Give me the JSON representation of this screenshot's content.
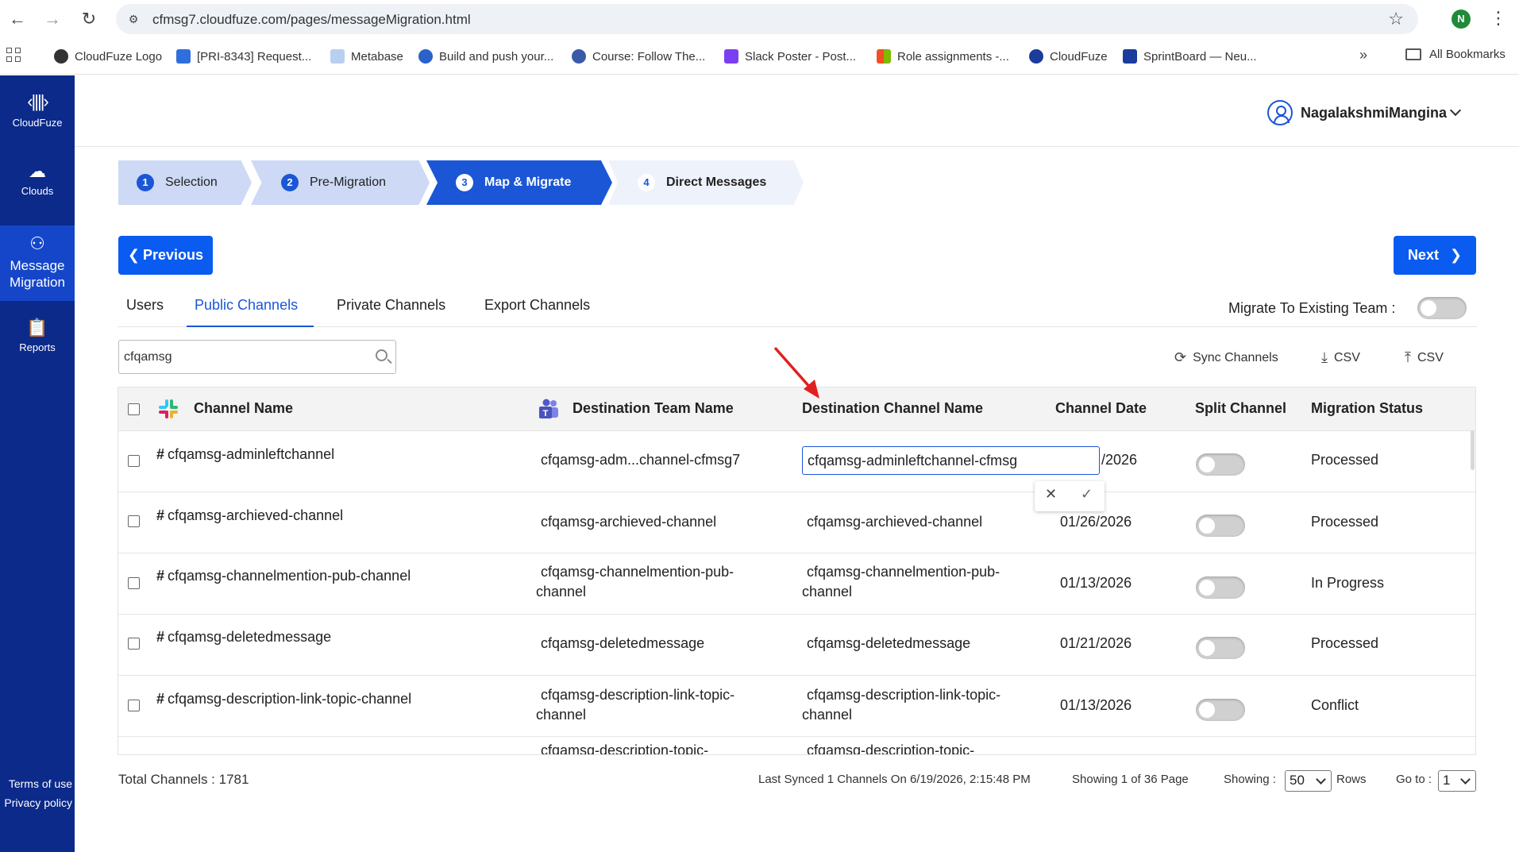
{
  "browser": {
    "url": "cfmsg7.cloudfuze.com/pages/messageMigration.html",
    "profile_initial": "N",
    "bookmarks": [
      {
        "label": "CloudFuze Logo",
        "color": "#333333"
      },
      {
        "label": "[PRI-8343] Request...",
        "color": "#2f6fdd"
      },
      {
        "label": "Metabase",
        "color": "#7aa7e0"
      },
      {
        "label": "Build and push your...",
        "color": "#2a62c9"
      },
      {
        "label": "Course: Follow The...",
        "color": "#3a5aa8"
      },
      {
        "label": "Slack Poster - Post...",
        "color": "#7b3ff2"
      },
      {
        "label": "Role assignments -...",
        "color": "#f25022"
      },
      {
        "label": "CloudFuze",
        "color": "#1a3c9c"
      },
      {
        "label": "SprintBoard — Neu...",
        "color": "#1a3c9c"
      }
    ],
    "all_bookmarks": "All Bookmarks"
  },
  "sidebar": {
    "brand": "CloudFuze",
    "items": [
      {
        "label": "Clouds",
        "icon": "cloud-icon"
      },
      {
        "label": "Message Migration",
        "icon": "users-icon"
      },
      {
        "label": "Reports",
        "icon": "clipboard-icon"
      }
    ],
    "terms": "Terms of use",
    "privacy": "Privacy policy"
  },
  "header": {
    "username": "NagalakshmiMangina"
  },
  "steps": [
    {
      "num": "1",
      "label": "Selection"
    },
    {
      "num": "2",
      "label": "Pre-Migration"
    },
    {
      "num": "3",
      "label": "Map & Migrate"
    },
    {
      "num": "4",
      "label": "Direct Messages"
    }
  ],
  "buttons": {
    "previous": "Previous",
    "next": "Next"
  },
  "tabs": [
    "Users",
    "Public Channels",
    "Private Channels",
    "Export Channels"
  ],
  "migrate_existing_label": "Migrate To Existing Team :",
  "search": {
    "value": "cfqamsg"
  },
  "actions": {
    "sync": "Sync Channels",
    "download_csv": "CSV",
    "upload_csv": "CSV"
  },
  "table": {
    "headers": {
      "channel": "Channel Name",
      "team": "Destination Team Name",
      "dest_channel": "Destination Channel Name",
      "date": "Channel Date",
      "split": "Split Channel",
      "status": "Migration Status"
    },
    "rows": [
      {
        "channel": "cfqamsg-adminleftchannel",
        "team": "cfqamsg-adm...channel-cfmsg7",
        "dest": "",
        "date": "/2026",
        "status": "Processed"
      },
      {
        "channel": "cfqamsg-archieved-channel",
        "team": "cfqamsg-archieved-channel",
        "dest": "cfqamsg-archieved-channel",
        "date": "01/26/2026",
        "status": "Processed"
      },
      {
        "channel": "cfqamsg-channelmention-pub-channel",
        "team": "cfqamsg-channelmention-pub-channel",
        "dest": "cfqamsg-channelmention-pub-channel",
        "date": "01/13/2026",
        "status": "In Progress"
      },
      {
        "channel": "cfqamsg-deletedmessage",
        "team": "cfqamsg-deletedmessage",
        "dest": "cfqamsg-deletedmessage",
        "date": "01/21/2026",
        "status": "Processed"
      },
      {
        "channel": "cfqamsg-description-link-topic-channel",
        "team": "cfqamsg-description-link-topic-channel",
        "dest": "cfqamsg-description-link-topic-channel",
        "date": "01/13/2026",
        "status": "Conflict"
      },
      {
        "channel": "",
        "team": "cfqamsg-description-topic-",
        "dest": "cfqamsg-description-topic-",
        "date": "",
        "status": ""
      }
    ],
    "edit_value": "cfqamsg-adminleftchannel-cfmsg"
  },
  "footer": {
    "total": "Total Channels : 1781",
    "last_synced": "Last Synced 1 Channels On 6/19/2026, 2:15:48 PM",
    "showing_page": "Showing 1 of 36 Page",
    "showing_label": "Showing :",
    "rows_value": "50",
    "rows_label": "Rows",
    "goto_label": "Go to :",
    "goto_value": "1"
  },
  "colors": {
    "sidebar": "#0b2a8a",
    "primary": "#0a5bf0",
    "accent": "#1a56d6",
    "arrow": "#e02020"
  }
}
